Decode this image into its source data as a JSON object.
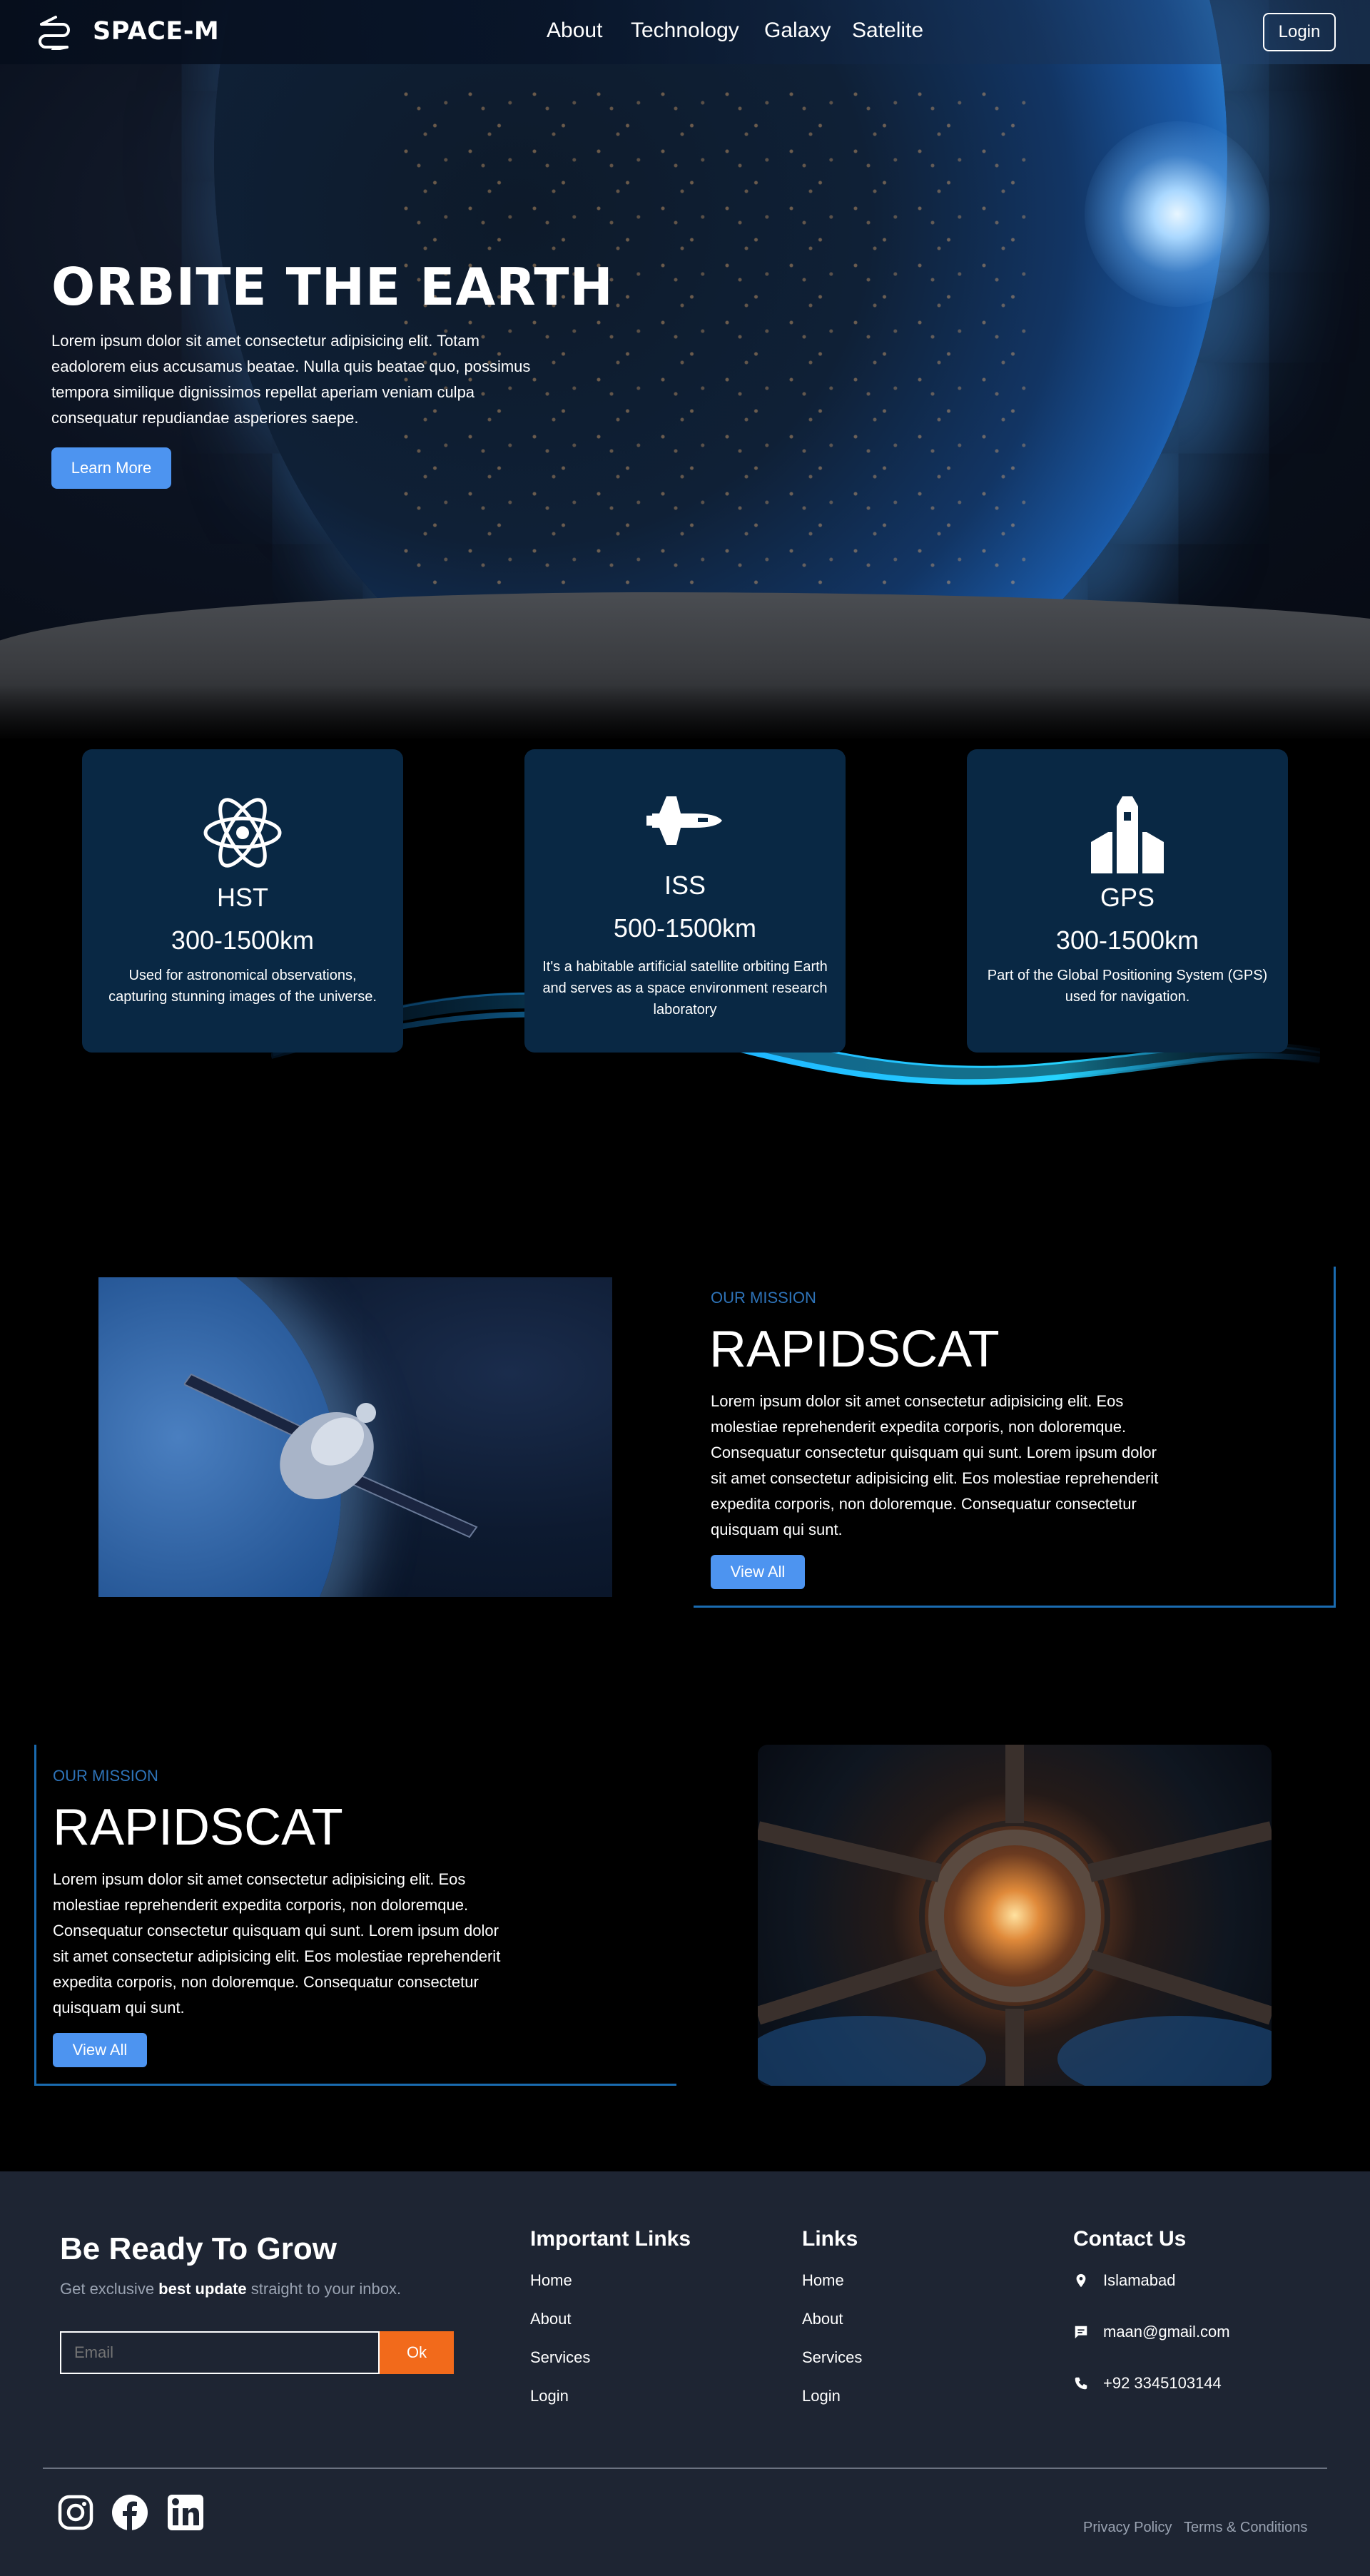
{
  "nav": {
    "brand": "SPACE-M",
    "links": [
      "About",
      "Technology",
      "Galaxy",
      "Satelite"
    ],
    "login": "Login"
  },
  "hero": {
    "title": "ORBITE THE EARTH",
    "text": "Lorem ipsum dolor sit amet consectetur adipisicing elit. Totam eadolorem eius accusamus beatae. Nulla quis beatae quo, possimus tempora similique dignissimos repellat aperiam veniam culpa consequatur repudiandae asperiores saepe.",
    "cta": "Learn More"
  },
  "cards": [
    {
      "icon": "atom-icon",
      "title": "HST",
      "range": "300-1500km",
      "desc": "Used for astronomical observations, capturing stunning images of the universe."
    },
    {
      "icon": "space-shuttle-icon",
      "title": "ISS",
      "range": "500-1500km",
      "desc": "It's a habitable artificial satellite orbiting Earth and serves as a space environment research laboratory"
    },
    {
      "icon": "rocket-icon",
      "title": "GPS",
      "range": "300-1500km",
      "desc": "Part of the Global Positioning System (GPS) used for navigation."
    }
  ],
  "missions": [
    {
      "kicker": "OUR MISSION",
      "title": "RAPIDSCAT",
      "text": "Lorem ipsum dolor sit amet consectetur adipisicing elit. Eos molestiae reprehenderit expedita corporis, non doloremque. Consequatur consectetur quisquam qui sunt. Lorem ipsum dolor sit amet consectetur adipisicing elit. Eos molestiae reprehenderit expedita corporis, non doloremque. Consequatur consectetur quisquam qui sunt.",
      "button": "View All"
    },
    {
      "kicker": "OUR MISSION",
      "title": "RAPIDSCAT",
      "text": "Lorem ipsum dolor sit amet consectetur adipisicing elit. Eos molestiae reprehenderit expedita corporis, non doloremque. Consequatur consectetur quisquam qui sunt. Lorem ipsum dolor sit amet consectetur adipisicing elit. Eos molestiae reprehenderit expedita corporis, non doloremque. Consequatur consectetur quisquam qui sunt.",
      "button": "View All"
    }
  ],
  "footer": {
    "grow_title": "Be Ready To Grow",
    "grow_sub_pre": "Get exclusive ",
    "grow_sub_bold": "best update",
    "grow_sub_post": " straight to your inbox.",
    "email_placeholder": "Email",
    "ok": "Ok",
    "important_links_title": "Important Links",
    "important_links": [
      "Home",
      "About",
      "Services",
      "Login"
    ],
    "links_title": "Links",
    "links": [
      "Home",
      "About",
      "Services",
      "Login"
    ],
    "contact_title": "Contact Us",
    "contact": {
      "location": "Islamabad",
      "email": "maan@gmail.com",
      "phone": "+92 3345103144"
    },
    "socials": [
      "instagram-icon",
      "facebook-icon",
      "linkedin-icon"
    ],
    "privacy": "Privacy Policy",
    "terms": "Terms & Conditions"
  },
  "colors": {
    "accent": "#4d94f0",
    "card": "#092844",
    "frame": "#1a6bb0",
    "ok": "#f26a1b",
    "footer": "#1e2533"
  }
}
